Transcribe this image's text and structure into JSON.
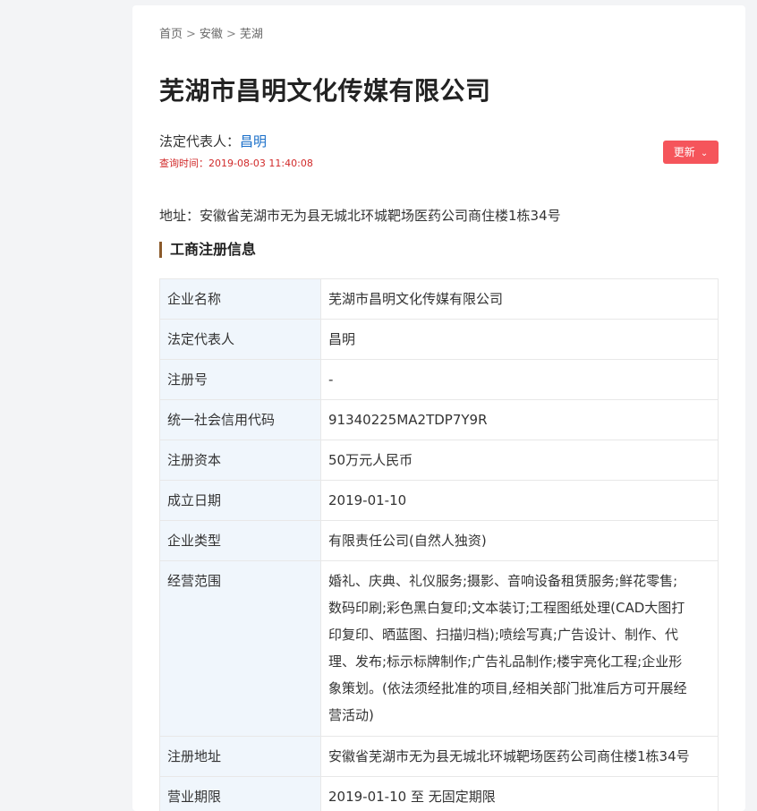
{
  "breadcrumb": {
    "home": "首页",
    "province": "安徽",
    "city": "芜湖",
    "separator": ">"
  },
  "company": {
    "title": "芜湖市昌明文化传媒有限公司",
    "legal_rep_label": "法定代表人：",
    "legal_rep_name": "昌明",
    "query_time": "查询时间：2019-08-03 11:40:08",
    "address": "地址：安徽省芜湖市无为县无城北环城靶场医药公司商住楼1栋34号"
  },
  "refresh_button": {
    "label": "更新",
    "color": "#f5555b"
  },
  "section": {
    "title": "工商注册信息",
    "accent_color": "#8b5a2b"
  },
  "table": {
    "rows": [
      {
        "label": "企业名称",
        "value": "芜湖市昌明文化传媒有限公司"
      },
      {
        "label": "法定代表人",
        "value": "昌明"
      },
      {
        "label": "注册号",
        "value": "-"
      },
      {
        "label": "统一社会信用代码",
        "value": "91340225MA2TDP7Y9R"
      },
      {
        "label": "注册资本",
        "value": "50万元人民币"
      },
      {
        "label": "成立日期",
        "value": "2019-01-10"
      },
      {
        "label": "企业类型",
        "value": "有限责任公司(自然人独资)"
      },
      {
        "label": "经营范围",
        "value_lines": [
          "婚礼、庆典、礼仪服务;摄影、音响设备租赁服务;鲜花零售;",
          "数码印刷;彩色黑白复印;文本装订;工程图纸处理(CAD大图打",
          "印复印、晒蓝图、扫描归档);喷绘写真;广告设计、制作、代",
          "理、发布;标示标牌制作;广告礼品制作;楼宇亮化工程;企业形",
          "象策划。(依法须经批准的项目,经相关部门批准后方可开展经",
          "营活动)"
        ]
      },
      {
        "label": "注册地址",
        "value": "安徽省芜湖市无为县无城北环城靶场医药公司商住楼1栋34号"
      },
      {
        "label": "营业期限",
        "value": "2019-01-10 至 无固定期限"
      }
    ]
  }
}
